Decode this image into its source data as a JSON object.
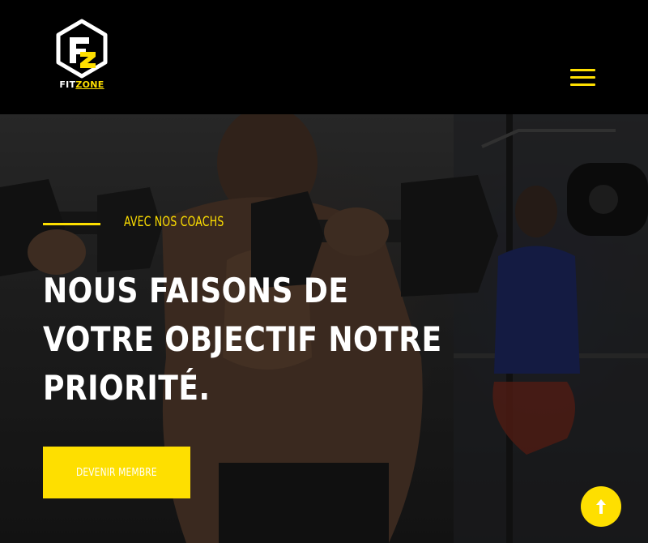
{
  "brand": {
    "logo_part1": "FIT",
    "logo_part2": "ZONE",
    "logo_icon": "fitzone-hexagon-logo",
    "accent_color": "#fedf00"
  },
  "nav": {
    "menu_icon": "hamburger-menu-icon"
  },
  "hero": {
    "eyebrow": "AVEC NOS COACHS",
    "headline_lines": [
      "NOUS FAISONS DE",
      "VOTRE OBJECTIF NOTRE",
      "PRIORITÉ."
    ],
    "cta_label": "DEVENIR MEMBRE",
    "background": "gym athlete lifting dumbbells"
  },
  "scroll_top": {
    "icon": "arrow-up-icon"
  }
}
